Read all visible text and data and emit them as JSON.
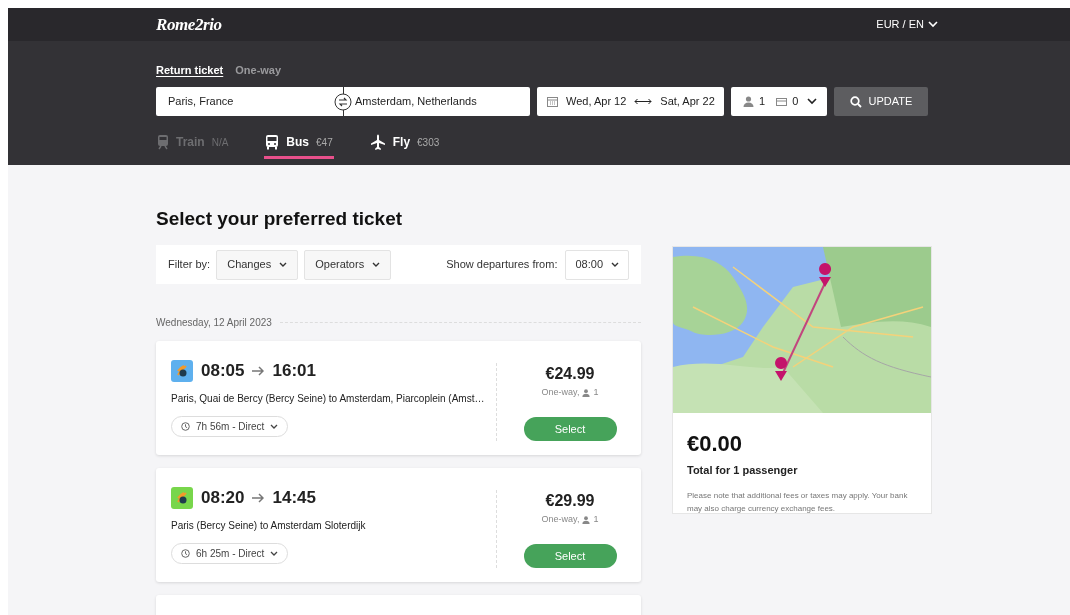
{
  "header": {
    "logo": "Rome2rio",
    "locale": "EUR / EN"
  },
  "trip_types": [
    {
      "label": "Return ticket",
      "selected": true
    },
    {
      "label": "One-way",
      "selected": false
    }
  ],
  "search": {
    "origin": "Paris, France",
    "destination": "Amsterdam, Netherlands",
    "depart_date": "Wed, Apr 12",
    "return_date": "Sat, Apr 22",
    "passengers": "1",
    "cards": "0",
    "button": "UPDATE"
  },
  "modes": [
    {
      "kind": "train",
      "label": "Train",
      "price": "N/A",
      "selected": false,
      "disabled": true
    },
    {
      "kind": "bus",
      "label": "Bus",
      "price": "€47",
      "selected": true,
      "disabled": false
    },
    {
      "kind": "plane",
      "label": "Fly",
      "price": "€303",
      "selected": false,
      "disabled": false
    }
  ],
  "heading": "Select your preferred ticket",
  "filters": {
    "label": "Filter by:",
    "dropdowns": [
      "Changes",
      "Operators"
    ],
    "departures_label": "Show departures from:",
    "departure_time": "08:00"
  },
  "date_divider": "Wednesday, 12 April 2023",
  "results": [
    {
      "color": "#5eb0ee",
      "depart": "08:05",
      "arrive": "16:01",
      "route": "Paris, Quai de Bercy (Bercy Seine) to Amsterdam, Piarcoplein (Amst…",
      "duration": "7h 56m - Direct",
      "price": "€24.99",
      "fare": "One-way,",
      "passengers": "1",
      "button": "Select"
    },
    {
      "color": "#78d64b",
      "depart": "08:20",
      "arrive": "14:45",
      "route": "Paris (Bercy Seine) to Amsterdam Sloterdijk",
      "duration": "6h 25m - Direct",
      "price": "€29.99",
      "fare": "One-way,",
      "passengers": "1",
      "button": "Select"
    }
  ],
  "summary": {
    "total": "€0.00",
    "caption": "Total for 1 passenger",
    "note": "Please note that additional fees or taxes may apply. Your bank may also charge currency exchange fees."
  }
}
